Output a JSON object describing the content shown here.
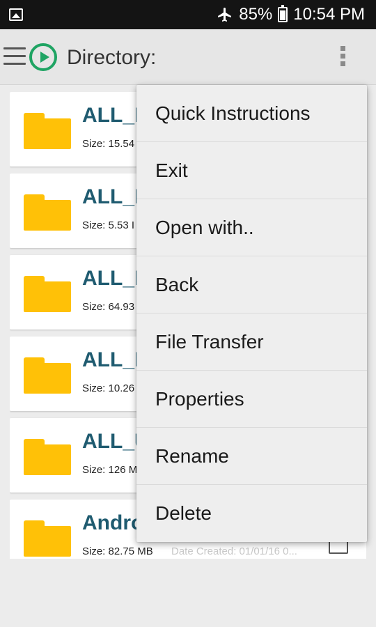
{
  "status_bar": {
    "battery": "85%",
    "time": "10:54 PM",
    "icons": [
      "image-notification-icon",
      "airplane-mode-icon",
      "battery-icon"
    ]
  },
  "toolbar": {
    "title": "Directory:",
    "icons": [
      "hamburger-menu-icon",
      "play-logo-icon",
      "overflow-menu-icon"
    ],
    "accent_color": "#1fa463"
  },
  "files": [
    {
      "name": "ALL_F",
      "size": "Size: 15.54",
      "date": ""
    },
    {
      "name": "ALL_F",
      "size": "Size: 5.53 I",
      "date": ""
    },
    {
      "name": "ALL_F",
      "size": "Size: 64.93",
      "date": ""
    },
    {
      "name": "ALL_F",
      "size": "Size: 10.26",
      "date": ""
    },
    {
      "name": "ALL_U",
      "size": "Size: 126 M",
      "date": ""
    },
    {
      "name": "Andro",
      "size": "Size: 82.75 MB",
      "date": "Date Created: 01/01/16 0..."
    }
  ],
  "file_colors": {
    "folder": "#ffc107",
    "name": "#1f5b70"
  },
  "menu": {
    "items": [
      {
        "label": "Quick Instructions"
      },
      {
        "label": "Exit"
      },
      {
        "label": "Open with.."
      },
      {
        "label": "Back"
      },
      {
        "label": "File Transfer"
      },
      {
        "label": "Properties"
      },
      {
        "label": "Rename"
      },
      {
        "label": "Delete"
      }
    ]
  }
}
